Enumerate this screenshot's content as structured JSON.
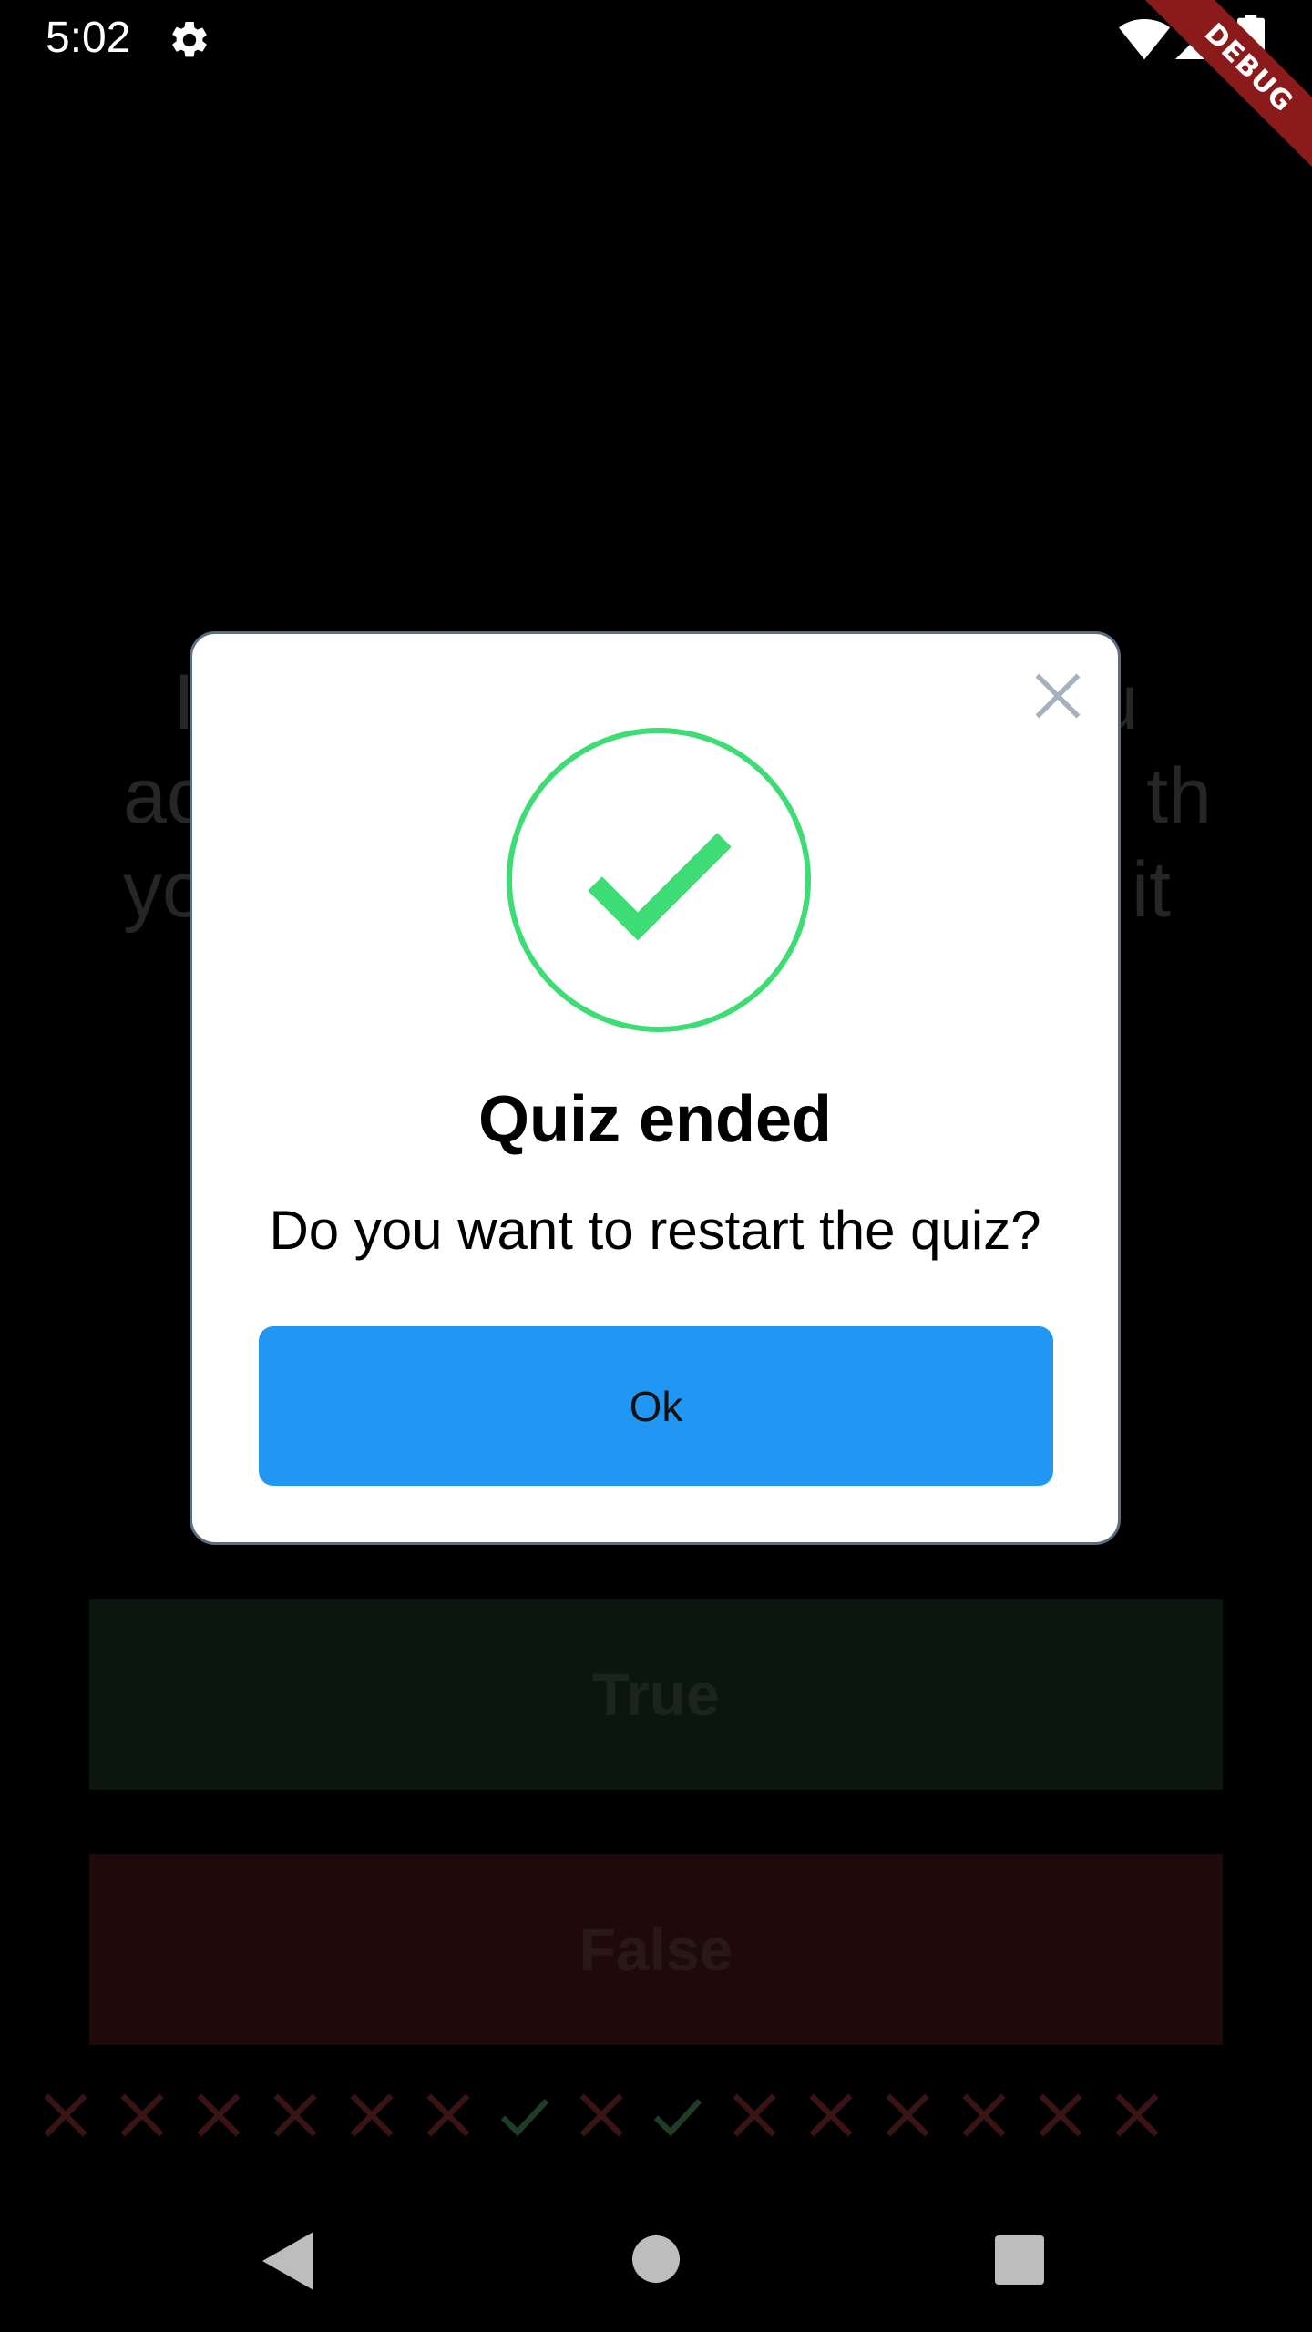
{
  "status_bar": {
    "time": "5:02",
    "icons": [
      "gear-icon",
      "wifi-icon",
      "signal-icon",
      "battery-icon"
    ],
    "debug_label": "DEBUG"
  },
  "background": {
    "question_lines": [
      "I",
      "ac",
      "yo"
    ],
    "question_right": [
      "u",
      "th",
      "it"
    ],
    "true_label": "True",
    "false_label": "False",
    "score": [
      "wrong",
      "wrong",
      "wrong",
      "wrong",
      "wrong",
      "wrong",
      "correct",
      "wrong",
      "correct",
      "wrong",
      "wrong",
      "wrong",
      "wrong",
      "wrong",
      "wrong"
    ]
  },
  "dialog": {
    "title": "Quiz ended",
    "message": "Do you want to restart the quiz?",
    "ok_label": "Ok",
    "success_color": "#3ddc74",
    "button_color": "#2196f3"
  },
  "nav_bar": {
    "icons": [
      "back-icon",
      "home-icon",
      "recents-icon"
    ]
  },
  "colors": {
    "correct": "#1f3d26",
    "wrong": "#3a1414"
  }
}
